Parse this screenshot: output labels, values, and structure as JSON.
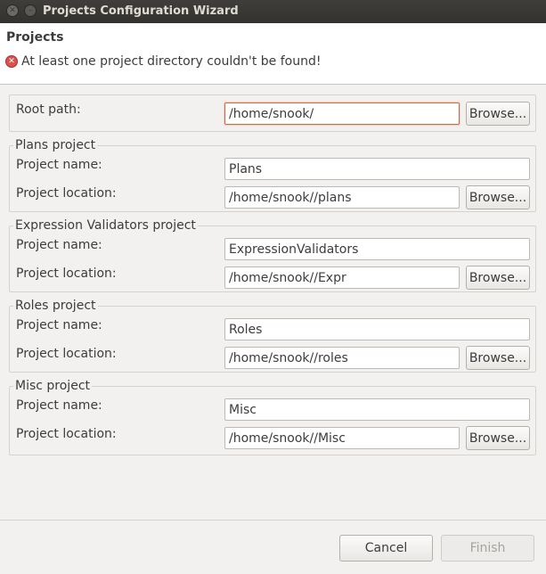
{
  "window": {
    "title": "Projects Configuration Wizard",
    "close_glyph": "✕",
    "minimize_glyph": "–"
  },
  "header": {
    "title": "Projects",
    "error_message": "At least one project directory couldn't be found!"
  },
  "root": {
    "label": "Root path:",
    "value": "/home/snook/",
    "browse_label": "Browse..."
  },
  "groups": [
    {
      "title": "Plans project",
      "name_label": "Project name:",
      "name_value": "Plans",
      "location_label": "Project location:",
      "location_value": "/home/snook//plans",
      "browse_label": "Browse..."
    },
    {
      "title": "Expression Validators project",
      "name_label": "Project name:",
      "name_value": "ExpressionValidators",
      "location_label": "Project location:",
      "location_value": "/home/snook//Expr",
      "browse_label": "Browse..."
    },
    {
      "title": "Roles project",
      "name_label": "Project name:",
      "name_value": "Roles",
      "location_label": "Project location:",
      "location_value": "/home/snook//roles",
      "browse_label": "Browse..."
    },
    {
      "title": "Misc project",
      "name_label": "Project name:",
      "name_value": "Misc",
      "location_label": "Project location:",
      "location_value": "/home/snook//Misc",
      "browse_label": "Browse..."
    }
  ],
  "footer": {
    "cancel_label": "Cancel",
    "finish_label": "Finish",
    "finish_enabled": false
  },
  "colors": {
    "error": "#d9534f",
    "focus_border": "#e0693b",
    "titlebar": "#3f3e3a"
  },
  "icons": {
    "error": "error-circle-icon",
    "close": "close-icon",
    "minimize": "minimize-icon"
  }
}
